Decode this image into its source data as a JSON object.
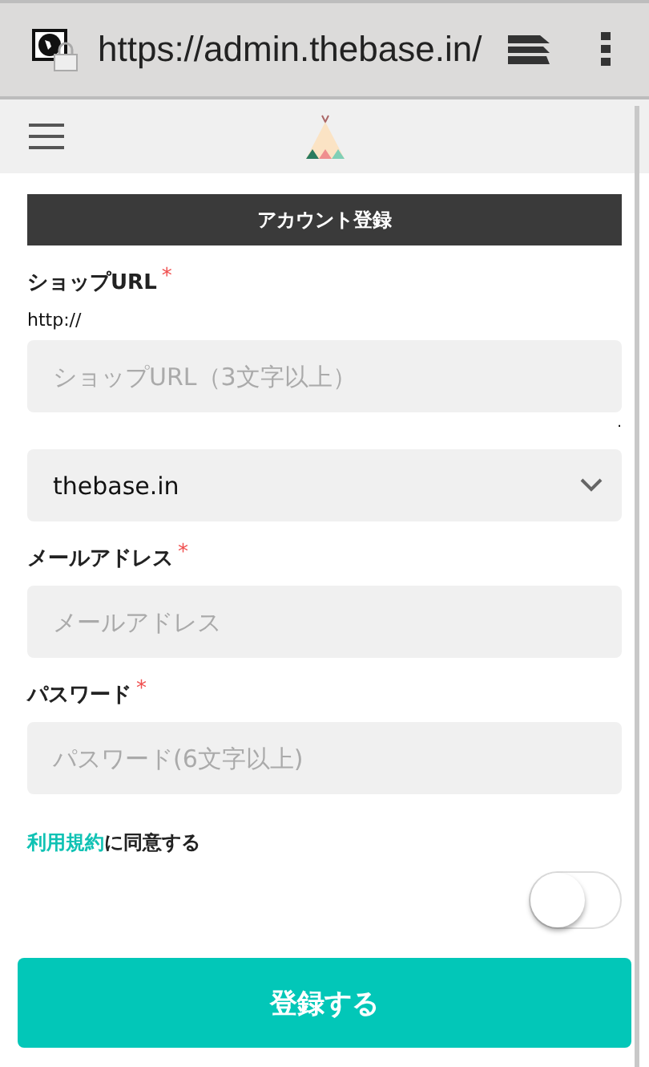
{
  "browser": {
    "url": "https://admin.thebase.in/"
  },
  "form": {
    "title": "アカウント登録",
    "fields": [
      {
        "kind": "text",
        "label": "ショップURL",
        "required_mark": "*",
        "prefix": "http://",
        "placeholder": "ショップURL（3文字以上）",
        "suffix": "."
      },
      {
        "kind": "select",
        "value": "thebase.in"
      },
      {
        "kind": "text",
        "label": "メールアドレス",
        "required_mark": "*",
        "placeholder": "メールアドレス"
      },
      {
        "kind": "text",
        "label": "パスワード",
        "required_mark": "*",
        "placeholder": "パスワード(6文字以上)"
      }
    ],
    "terms": {
      "link": "利用規約",
      "text": "に同意する",
      "on": false
    },
    "submit": "登録する"
  }
}
